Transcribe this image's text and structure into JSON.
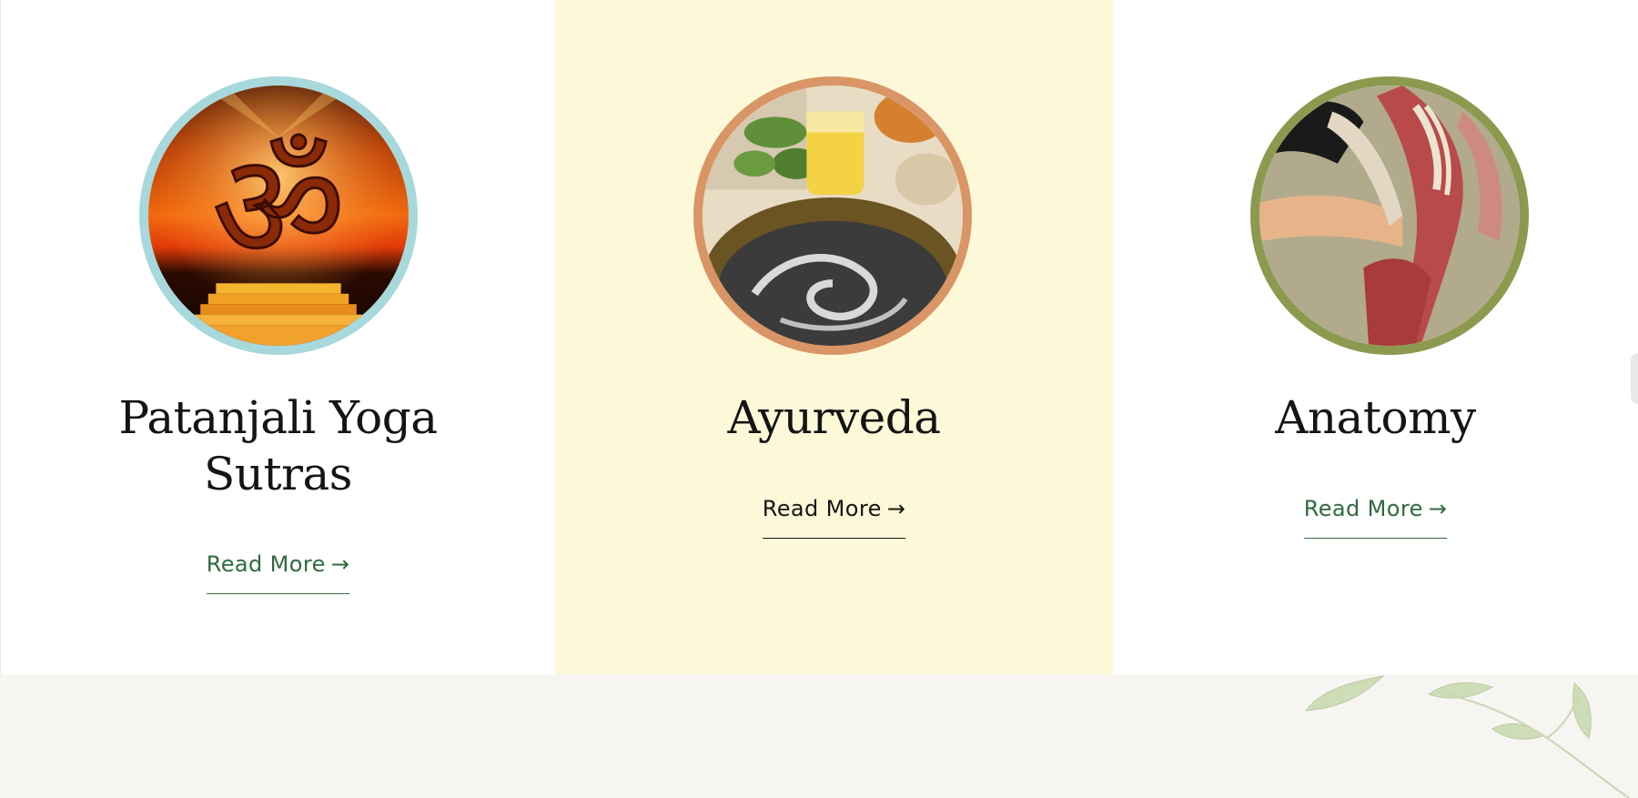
{
  "cards": [
    {
      "title_line1": "Patanjali Yoga",
      "title_line2": "Sutras",
      "image": "om-symbol-sunset",
      "read_more": "Read More",
      "arrow_icon": "arrow-right-icon",
      "ring_color": "#a7d8dc"
    },
    {
      "title_line1": "Ayurveda",
      "image": "ayurveda-herbs-bowl",
      "read_more": "Read More",
      "arrow_icon": "arrow-right-icon",
      "ring_color": "#d99565"
    },
    {
      "title_line1": "Anatomy",
      "image": "muscle-anatomy-illustration",
      "read_more": "Read More",
      "arrow_icon": "arrow-right-icon",
      "ring_color": "#8c9a4f"
    }
  ],
  "colors": {
    "link_green": "#2f6a3e",
    "highlight_bg": "#fdf9d8",
    "footer_bg": "#f6f5f2"
  },
  "decor": {
    "footer_icon": "leaf-branch-icon"
  }
}
